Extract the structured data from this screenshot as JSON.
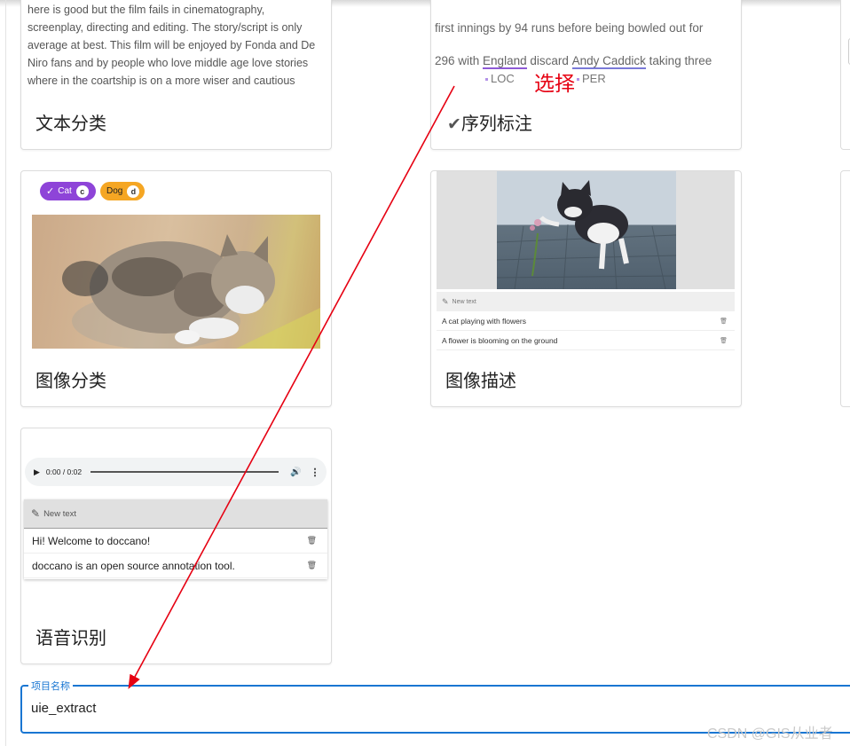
{
  "cards": {
    "text_classification": {
      "preview_lines": [
        "here is good but the film fails in cinematography,",
        "screenplay, directing and editing. The story/script is only",
        "average at best. This film will be enjoyed by Fonda and De",
        "Niro fans and by people who love middle age love stories",
        "where in the coartship is on a more wiser and cautious"
      ],
      "title": "文本分类"
    },
    "sequence_labeling": {
      "line1": "first innings by 94 runs before being bowled out for",
      "line2_prefix": "296 with ",
      "entity1": "England",
      "middle": " discard ",
      "entity2": "Andy Caddick",
      "line2_suffix": " taking three",
      "tag1": "LOC",
      "tag2": "PER",
      "annotation": "选择",
      "check_glyph": "✔",
      "title": "序列标注"
    },
    "image_classification": {
      "chips": [
        {
          "label": "Cat",
          "key": "c",
          "color": "#8e44d8",
          "check": "✓"
        },
        {
          "label": "Dog",
          "key": "d",
          "color": "#f5a623"
        }
      ],
      "title": "图像分类"
    },
    "image_captioning": {
      "toolbar_label": "New text",
      "rows": [
        "A cat playing with flowers",
        "A flower is blooming on the ground"
      ],
      "title": "图像描述"
    },
    "speech_recognition": {
      "audio_time": "0:00 / 0:02",
      "toolbar_label": "New text",
      "rows": [
        "Hi! Welcome to doccano!",
        "doccano is an open source annotation tool."
      ],
      "title": "语音识别"
    }
  },
  "project_field": {
    "label": "项目名称",
    "value": "uie_extract"
  },
  "watermark": "CSDN @GIS从业者",
  "colors": {
    "accent_blue": "#1976d2",
    "annotation_red": "#e60012",
    "loc_underline": "#8e5ad6",
    "per_underline": "#7a7ad8"
  },
  "icons": [
    "check-icon",
    "pencil-icon",
    "trash-icon",
    "play-icon",
    "volume-icon",
    "more-vert-icon"
  ]
}
